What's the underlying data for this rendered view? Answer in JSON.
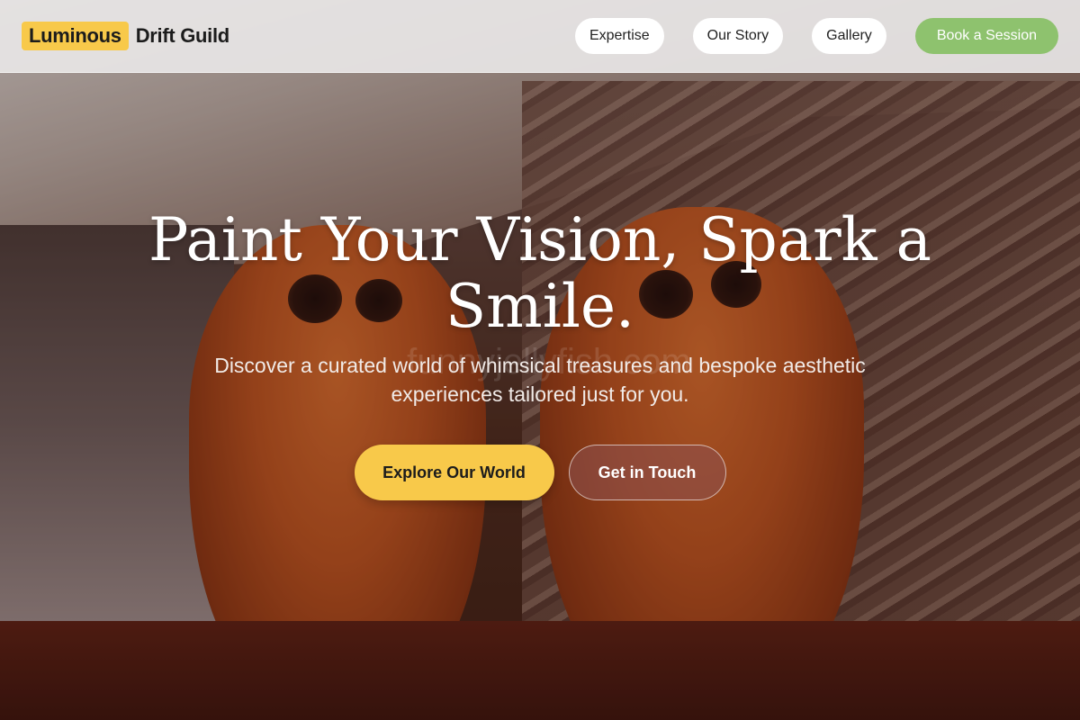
{
  "header": {
    "logo_highlight": "Luminous",
    "logo_rest": "Drift Guild",
    "nav": [
      {
        "label": "Expertise"
      },
      {
        "label": "Our Story"
      },
      {
        "label": "Gallery"
      }
    ],
    "cta_label": "Book a Session"
  },
  "hero": {
    "headline": "Paint Your Vision, Spark a Smile.",
    "subheadline": "Discover a curated world of whimsical treasures and bespoke aesthetic experiences tailored just for you.",
    "primary_button": "Explore Our World",
    "secondary_button": "Get in Touch",
    "watermark": "funnyjellyfish.com",
    "background_image": "carved-coconut-monkey-figurines"
  },
  "colors": {
    "accent_yellow": "#f8c94a",
    "accent_green": "#8ec26e",
    "secondary_button_bg": "#8c5050"
  }
}
